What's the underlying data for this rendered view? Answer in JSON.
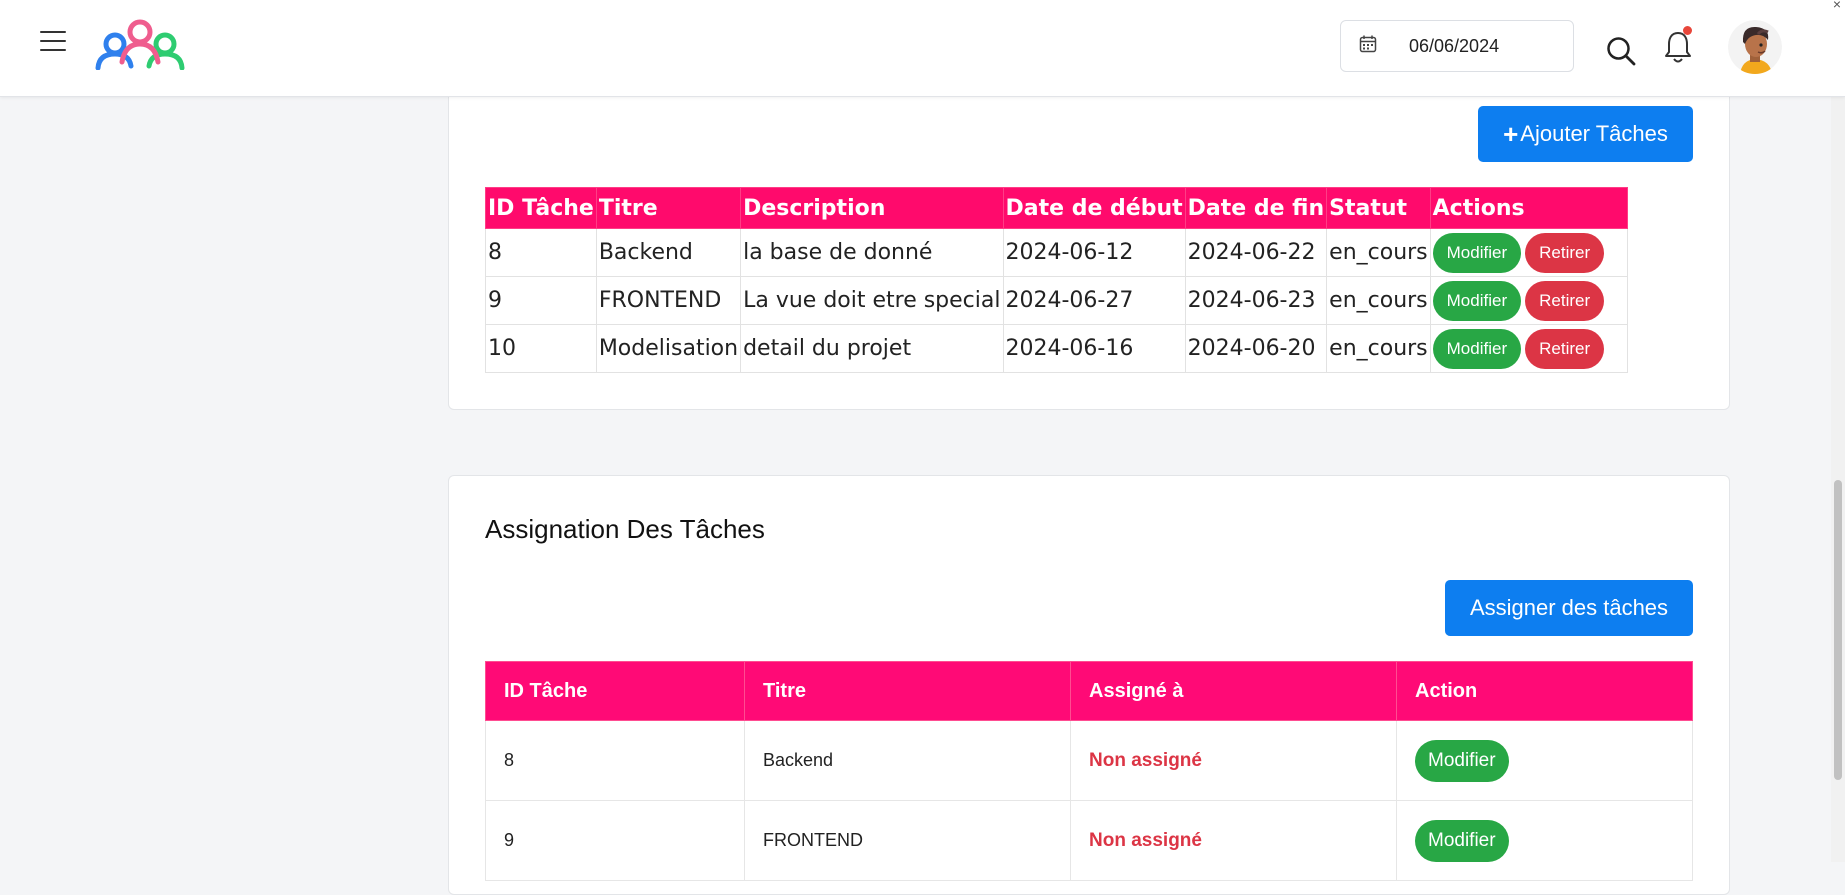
{
  "header": {
    "date": "06/06/2024"
  },
  "tasks": {
    "add_button": "Ajouter Tâches",
    "columns": [
      "ID Tâche",
      "Titre",
      "Description",
      "Date de début",
      "Date de fin",
      "Statut",
      "Actions"
    ],
    "rows": [
      {
        "id": "8",
        "title": "Backend",
        "description": "la base de donné",
        "start": "2024-06-12",
        "end": "2024-06-22",
        "status": "en_cours"
      },
      {
        "id": "9",
        "title": "FRONTEND",
        "description": "La vue doit etre special",
        "start": "2024-06-27",
        "end": "2024-06-23",
        "status": "en_cours"
      },
      {
        "id": "10",
        "title": "Modelisation",
        "description": "detail du projet",
        "start": "2024-06-16",
        "end": "2024-06-20",
        "status": "en_cours"
      }
    ],
    "modify_label": "Modifier",
    "remove_label": "Retirer"
  },
  "assignments": {
    "title": "Assignation Des Tâches",
    "assign_button": "Assigner des tâches",
    "columns": [
      "ID Tâche",
      "Titre",
      "Assigné à",
      "Action"
    ],
    "rows": [
      {
        "id": "8",
        "title": "Backend",
        "assigned_to": "Non assigné"
      },
      {
        "id": "9",
        "title": "FRONTEND",
        "assigned_to": "Non assigné"
      }
    ],
    "modify_label": "Modifier"
  },
  "colors": {
    "header_pink": "#ff0a6c",
    "primary_blue": "#0d7ef0",
    "success_green": "#28a745",
    "danger_red": "#dc3545"
  },
  "icons": [
    "menu-icon",
    "team-logo",
    "calendar-icon",
    "search-icon",
    "bell-icon",
    "avatar",
    "plus-icon"
  ]
}
